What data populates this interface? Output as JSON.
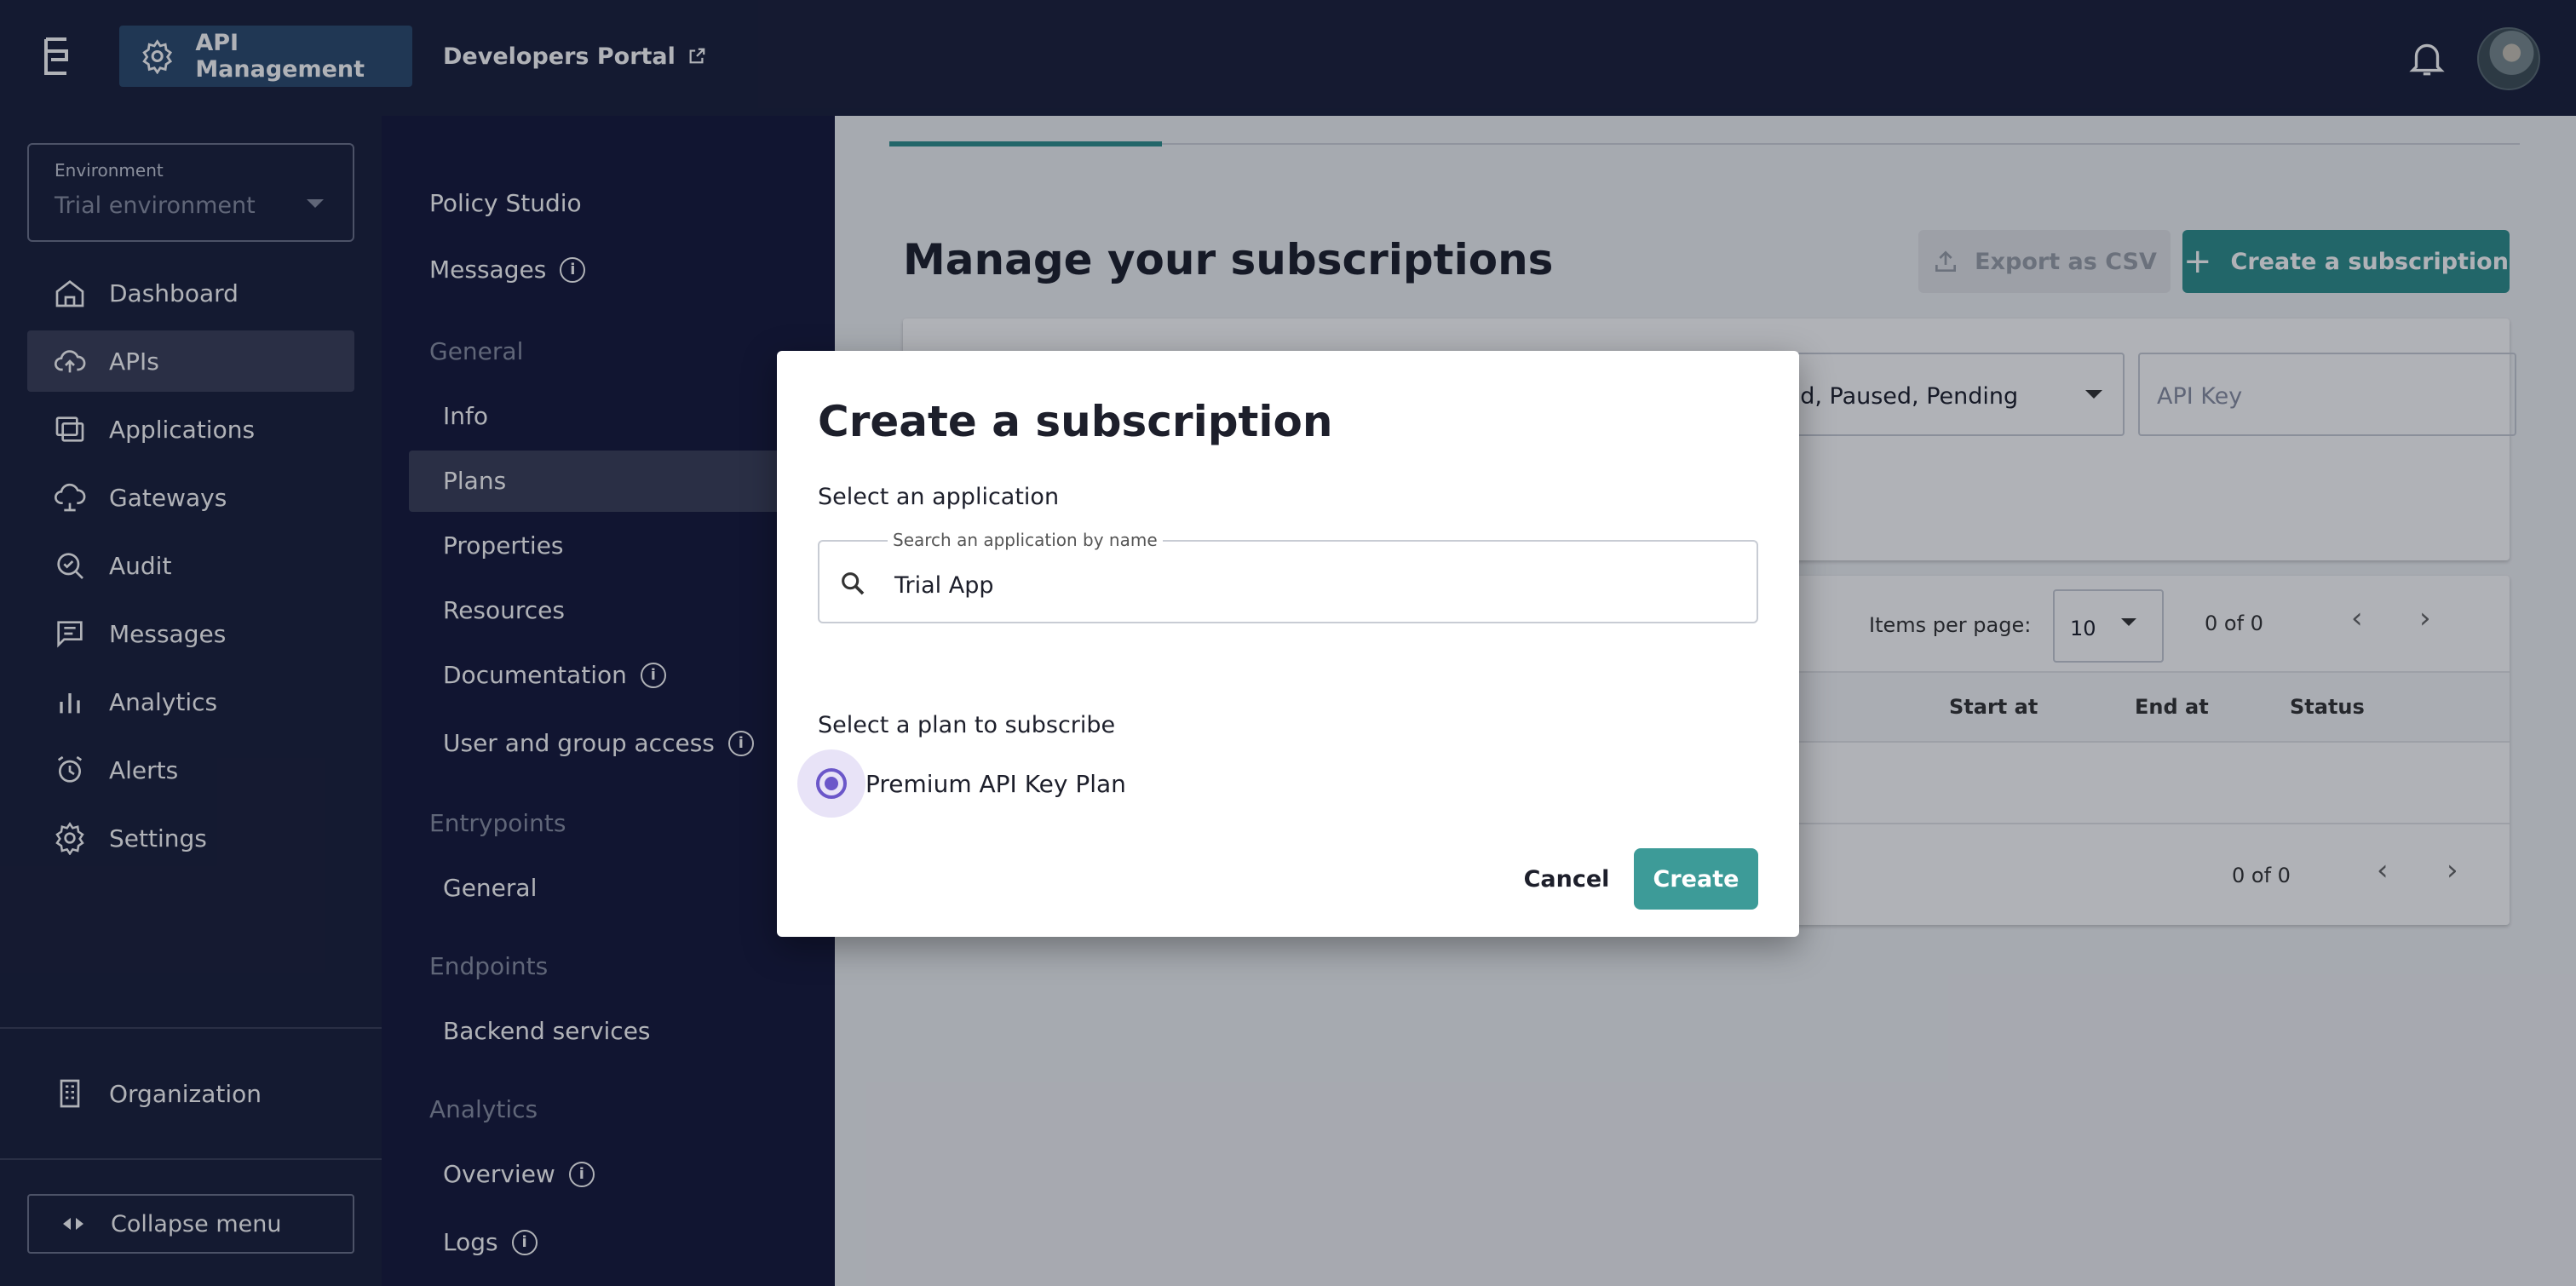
{
  "topbar": {
    "app_label": "API Management",
    "portal_label": "Developers Portal"
  },
  "sidebar": {
    "environment_label": "Environment",
    "environment_value": "Trial environment",
    "items": [
      {
        "label": "Dashboard",
        "icon": "home-icon"
      },
      {
        "label": "APIs",
        "icon": "cloud-upload-icon"
      },
      {
        "label": "Applications",
        "icon": "applications-icon"
      },
      {
        "label": "Gateways",
        "icon": "gateway-icon"
      },
      {
        "label": "Audit",
        "icon": "audit-search-icon"
      },
      {
        "label": "Messages",
        "icon": "message-icon"
      },
      {
        "label": "Analytics",
        "icon": "bar-chart-icon"
      },
      {
        "label": "Alerts",
        "icon": "alarm-icon"
      },
      {
        "label": "Settings",
        "icon": "gear-icon"
      }
    ],
    "organization": "Organization",
    "collapse": "Collapse menu"
  },
  "subnav": {
    "policy_studio": "Policy Studio",
    "messages": "Messages",
    "general_head": "General",
    "info": "Info",
    "plans": "Plans",
    "properties": "Properties",
    "resources": "Resources",
    "documentation": "Documentation",
    "user_group_access": "User and group access",
    "entrypoints_head": "Entrypoints",
    "entry_general": "General",
    "endpoints_head": "Endpoints",
    "backend_services": "Backend services",
    "analytics_head": "Analytics",
    "overview": "Overview",
    "logs": "Logs",
    "info_glyph": "i"
  },
  "main": {
    "title": "Manage your subscriptions",
    "export_label": "Export as CSV",
    "create_label": "Create a subscription",
    "status_value": "ted, Paused, Pending",
    "apikey_placeholder": "API Key",
    "items_per_page_label": "Items per page:",
    "items_per_page_value": "10",
    "top_page_count": "0 of 0",
    "bottom_page_count": "0 of 0",
    "columns": {
      "start_at": "Start at",
      "end_at": "End at",
      "status": "Status"
    }
  },
  "dialog": {
    "title": "Create a subscription",
    "select_app_label": "Select an application",
    "search_label": "Search an application by name",
    "search_value": "Trial App",
    "select_plan_label": "Select a plan to subscribe",
    "plan_option": "Premium API Key Plan",
    "cancel": "Cancel",
    "create": "Create"
  },
  "colors": {
    "accent_teal": "#2f8f8c",
    "radio_purple": "#6b57c9",
    "nav_bg": "#1a1f3a"
  }
}
